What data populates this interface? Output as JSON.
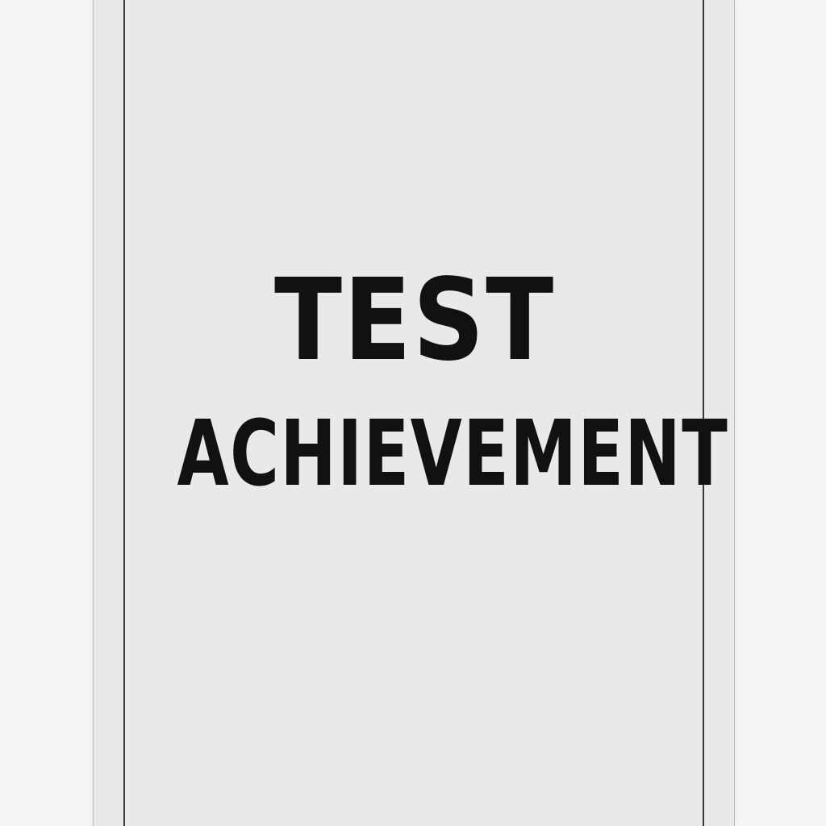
{
  "document": {
    "title_line_1": "TEST",
    "title_line_2": "ACHIEVEMENT"
  },
  "colors": {
    "background": "#f5f5f5",
    "card": "#e9e9eb",
    "frame_line": "#3a3a3a",
    "text": "#111111"
  }
}
